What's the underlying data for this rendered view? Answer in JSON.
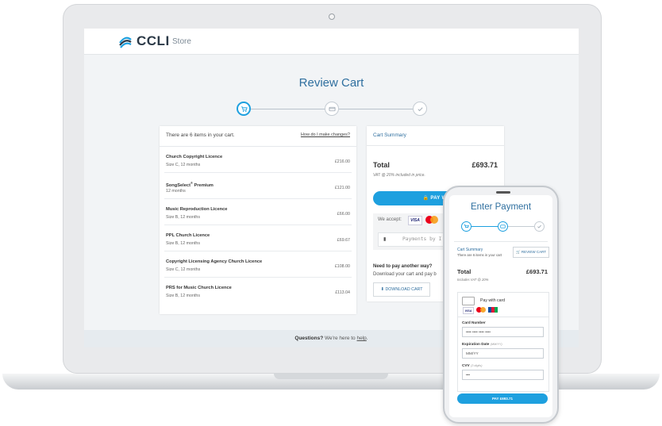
{
  "laptop": {
    "header": {
      "logo_text": "CCLI",
      "store_label": "Store"
    },
    "page_title": "Review Cart",
    "steps": [
      {
        "icon": "cart-icon",
        "glyph": "🛒",
        "active": true
      },
      {
        "icon": "card-icon",
        "glyph": "▭",
        "active": false
      },
      {
        "icon": "check-icon",
        "glyph": "✓",
        "active": false
      }
    ],
    "cart": {
      "count_text": "There are 6 items in your cart.",
      "change_link": "How do I make changes?",
      "items": [
        {
          "name": "Church Copyright Licence",
          "sup": "",
          "sub": "Size C, 12 months",
          "price": "£216.00"
        },
        {
          "name": "SongSelect",
          "sup": "®",
          "name_suffix": " Premium",
          "sub": "12 months",
          "price": "£121.00"
        },
        {
          "name": "Music Reproduction Licence",
          "sup": "",
          "sub": "Size B, 12 months",
          "price": "£66.00"
        },
        {
          "name": "PPL Church Licence",
          "sup": "",
          "sub": "Size B, 12 months",
          "price": "£69.67"
        },
        {
          "name": "Copyright Licensing Agency Church Licence",
          "sup": "",
          "sub": "Size C, 12 months",
          "price": "£108.00"
        },
        {
          "name": "PRS for Music Church Licence",
          "sup": "",
          "sub": "Size B, 12 months",
          "price": "£113.04"
        }
      ]
    },
    "summary": {
      "title": "Cart Summary",
      "total_label": "Total",
      "total_value": "£693.71",
      "vat_note": "VAT @ 20% included in price.",
      "pay_button": "🔒  PAY WITH A",
      "accept_label": "We accept:",
      "visa_label": "VISA",
      "payments_text": "Payments by I",
      "other_title": "Need to pay another way?",
      "other_sub": "Download your cart and pay b",
      "download_button": "⬇  DOWNLOAD CART"
    },
    "footer": {
      "bold": "Questions?",
      "text": " We're here to ",
      "link": "help",
      "end": "."
    }
  },
  "phone": {
    "title": "Enter Payment",
    "summary_title": "Cart Summary",
    "summary_sub": "There are 6 items in your cart",
    "review_button": "🛒 REVIEW CART",
    "total_label": "Total",
    "total_value": "£693.71",
    "vat_note": "Includes VAT @ 20%",
    "pay_with": "Pay with card",
    "visa_label": "VISA",
    "card_number_label": "Card Number",
    "card_number_value": "•••• •••• •••• ••••",
    "expiry_label": "Expiration Date",
    "expiry_hint": "(MM/YY)",
    "expiry_value": "MM/YY",
    "cvv_label": "CVV",
    "cvv_hint": "(3 digits)",
    "cvv_value": "•••",
    "pay_button": "PAY £693.71"
  },
  "colors": {
    "accent": "#1ea0df",
    "title_blue": "#2f6f9f",
    "dark": "#2b3947"
  }
}
